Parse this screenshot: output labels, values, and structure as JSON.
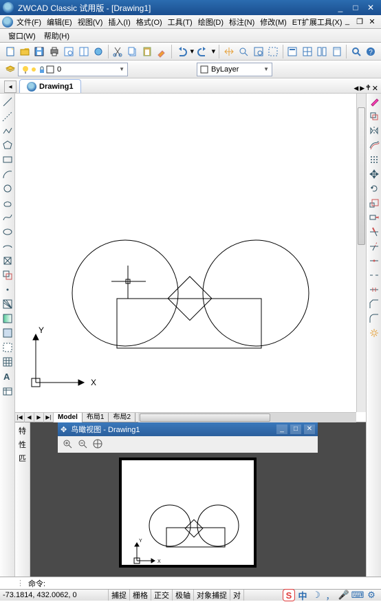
{
  "app": {
    "title": "ZWCAD Classic 试用版 - [Drawing1]"
  },
  "menus": {
    "file": "文件(F)",
    "edit": "编辑(E)",
    "view": "视图(V)",
    "insert": "插入(I)",
    "format": "格式(O)",
    "tools": "工具(T)",
    "draw": "绘图(D)",
    "annotate": "标注(N)",
    "modify": "修改(M)",
    "ext": "ET扩展工具(X)",
    "window": "窗口(W)",
    "help": "帮助(H)"
  },
  "tabs": {
    "doc": "Drawing1"
  },
  "layers": {
    "name": "0"
  },
  "bylayer": {
    "label": "ByLayer"
  },
  "layout_tabs": {
    "model": "Model",
    "layout1": "布局1",
    "layout2": "布局2"
  },
  "aerial": {
    "title": "鸟瞰视图 - Drawing1"
  },
  "sidebar_text": {
    "c1": "特",
    "c2": "性",
    "c3": "匹"
  },
  "cmd": {
    "prompt": "命令:"
  },
  "status": {
    "coords": "-73.1814, 432.0062, 0",
    "snap": "捕捉",
    "grid": "栅格",
    "ortho": "正交",
    "polar": "极轴",
    "osnap": "对象捕捉",
    "more": "对"
  },
  "axes": {
    "x": "X",
    "y": "Y"
  },
  "tray": {
    "lang": "中"
  }
}
